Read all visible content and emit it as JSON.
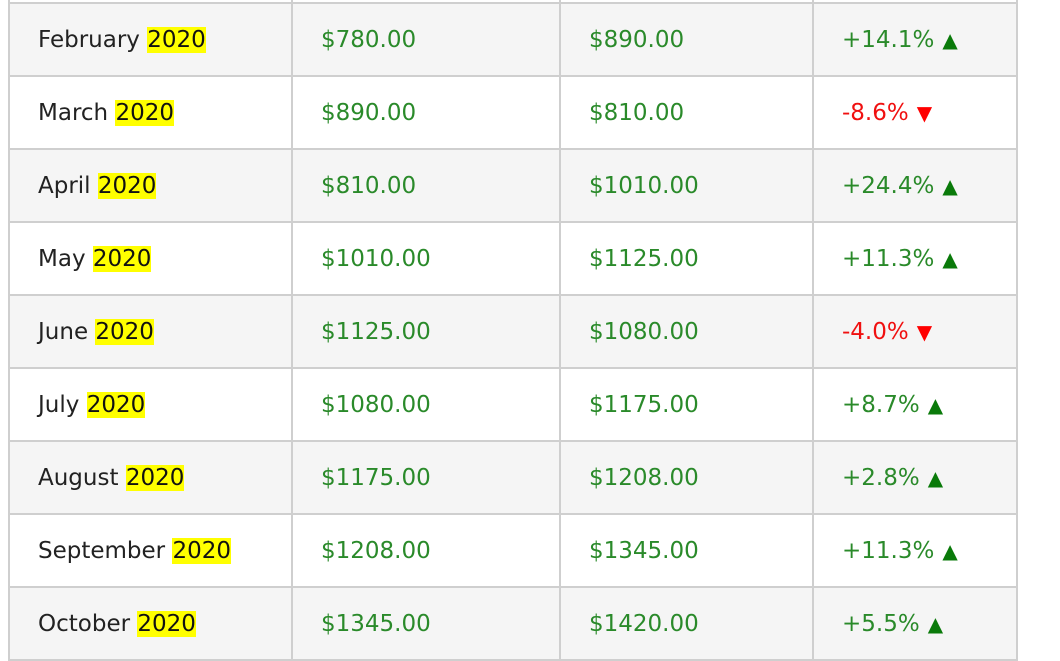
{
  "rows": [
    {
      "month": "",
      "year": "",
      "open": "",
      "close": "",
      "change": "",
      "direction": "up"
    },
    {
      "month": "February",
      "year": "2020",
      "open": "$780.00",
      "close": "$890.00",
      "change": "+14.1%",
      "direction": "up"
    },
    {
      "month": "March",
      "year": "2020",
      "open": "$890.00",
      "close": "$810.00",
      "change": "-8.6%",
      "direction": "down"
    },
    {
      "month": "April",
      "year": "2020",
      "open": "$810.00",
      "close": "$1010.00",
      "change": "+24.4%",
      "direction": "up"
    },
    {
      "month": "May",
      "year": "2020",
      "open": "$1010.00",
      "close": "$1125.00",
      "change": "+11.3%",
      "direction": "up"
    },
    {
      "month": "June",
      "year": "2020",
      "open": "$1125.00",
      "close": "$1080.00",
      "change": "-4.0%",
      "direction": "down"
    },
    {
      "month": "July",
      "year": "2020",
      "open": "$1080.00",
      "close": "$1175.00",
      "change": "+8.7%",
      "direction": "up"
    },
    {
      "month": "August",
      "year": "2020",
      "open": "$1175.00",
      "close": "$1208.00",
      "change": "+2.8%",
      "direction": "up"
    },
    {
      "month": "September",
      "year": "2020",
      "open": "$1208.00",
      "close": "$1345.00",
      "change": "+11.3%",
      "direction": "up"
    },
    {
      "month": "October",
      "year": "2020",
      "open": "$1345.00",
      "close": "$1420.00",
      "change": "+5.5%",
      "direction": "up"
    }
  ],
  "arrows": {
    "up": "▲",
    "down": "▼"
  },
  "colors": {
    "positive": "#2a8a2a",
    "negative": "#f01010",
    "highlight": "#ffff00"
  }
}
